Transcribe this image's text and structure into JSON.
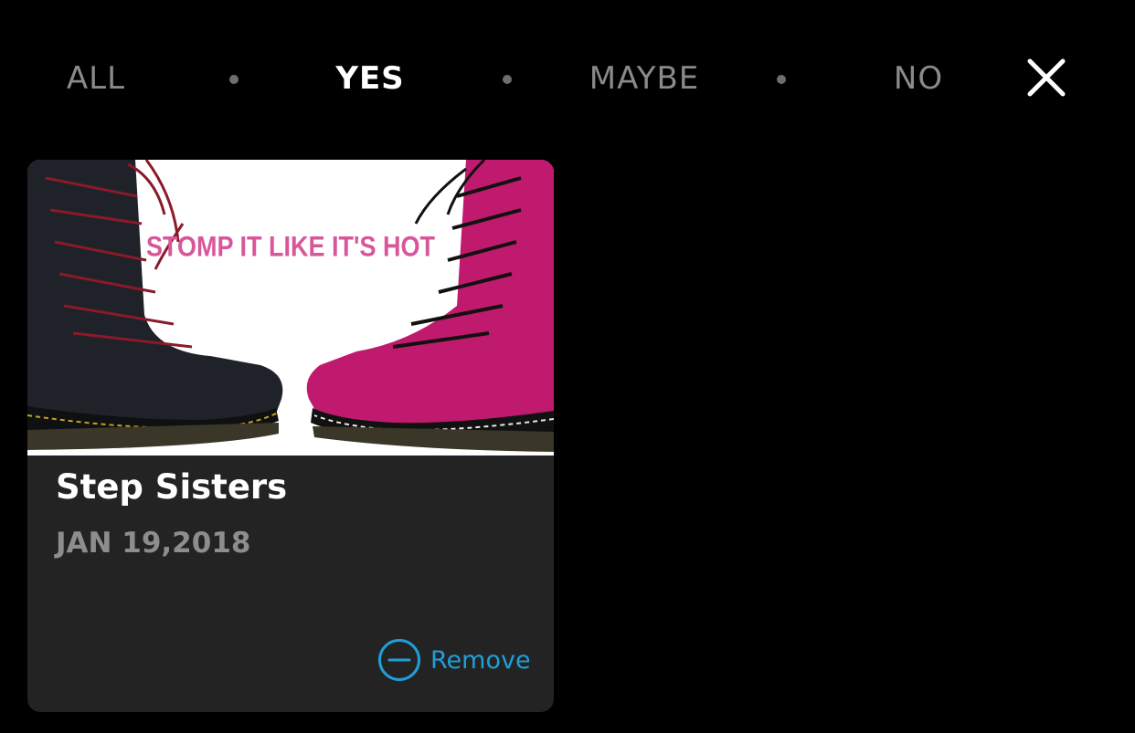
{
  "tabs": [
    {
      "label": "ALL",
      "active": false
    },
    {
      "label": "YES",
      "active": true
    },
    {
      "label": "MAYBE",
      "active": false
    },
    {
      "label": "NO",
      "active": false
    }
  ],
  "close_icon": "close-icon",
  "card": {
    "image_text": "STOMP IT LIKE IT'S HOT",
    "title": "Step Sisters",
    "date": "JAN 19,2018",
    "remove_label": "Remove",
    "remove_icon": "minus-circle-icon"
  },
  "colors": {
    "background": "#000000",
    "card_background": "#232323",
    "active_tab": "#ffffff",
    "inactive_tab": "#8a8a8a",
    "accent": "#1e9fd8",
    "promo_pink": "#d8569a",
    "boot_black": "#1f2228",
    "boot_pink": "#c01a6e",
    "lace_red": "#8a1a2a"
  }
}
